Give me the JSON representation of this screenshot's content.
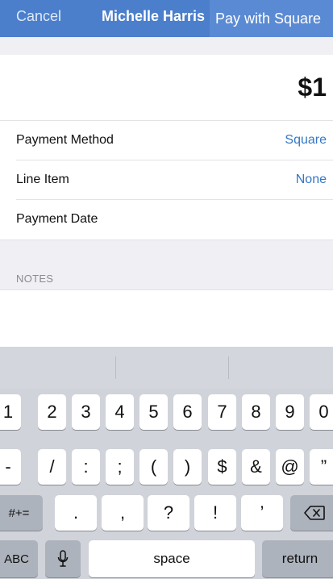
{
  "nav": {
    "cancel_label": "Cancel",
    "title": "Michelle Harris",
    "pay_label": "Pay with Square"
  },
  "amount": {
    "value": "$1"
  },
  "form_rows": [
    {
      "label": "Payment Method",
      "value": "Square"
    },
    {
      "label": "Line Item",
      "value": "None"
    },
    {
      "label": "Payment Date",
      "value": ""
    }
  ],
  "notes": {
    "header": "NOTES",
    "value": ""
  },
  "keyboard": {
    "row1": [
      "1",
      "2",
      "3",
      "4",
      "5",
      "6",
      "7",
      "8",
      "9",
      "0"
    ],
    "row2": [
      "-",
      "/",
      ":",
      ";",
      "(",
      ")",
      "$",
      "&",
      "@",
      "”"
    ],
    "row3_mode": "#+=",
    "row3": [
      ".",
      ",",
      "?",
      "!",
      "’"
    ],
    "abc_label": "ABC",
    "space_label": "space",
    "return_label": "return"
  },
  "colors": {
    "nav_bar": "#4b7fcb",
    "accent_value": "#3478c4"
  }
}
